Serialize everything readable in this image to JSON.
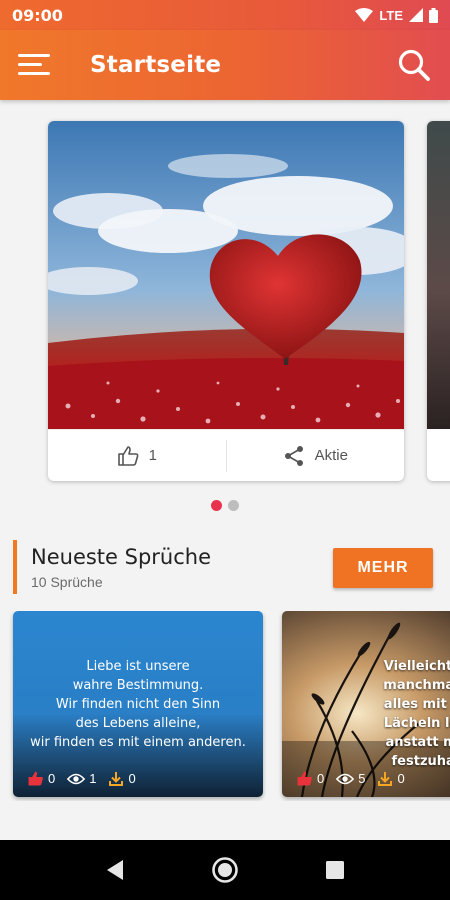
{
  "status_bar": {
    "time": "09:00",
    "network": "LTE"
  },
  "app_bar": {
    "title": "Startseite",
    "menu_icon": "menu-icon",
    "search_icon": "search-icon"
  },
  "carousel": {
    "cards": [
      {
        "image": "red heart tree in flower field",
        "likes": "1",
        "share_label": "Aktie"
      }
    ],
    "pages": 2,
    "active_page": 1
  },
  "section": {
    "title": "Neueste Sprüche",
    "subtitle": "10 Sprüche",
    "more_button": "MEHR"
  },
  "quotes": [
    {
      "lines": [
        "Liebe ist unsere",
        "wahre Bestimmung.",
        "Wir finden nicht den Sinn",
        "des Lebens alleine,",
        "wir finden es mit einem anderen."
      ],
      "likes": "0",
      "views": "1",
      "downloads": "0"
    },
    {
      "lines": [
        "Vielleicht ist es",
        "manchmal bess",
        "alles mit einem",
        "Lächeln loszula",
        "anstatt mit Trä",
        "festzuhalten."
      ],
      "likes": "0",
      "views": "5",
      "downloads": "0"
    }
  ],
  "colors": {
    "accent": "#ef7322",
    "active_dot": "#e8334e",
    "like": "#e8333c",
    "download": "#f5a623"
  }
}
